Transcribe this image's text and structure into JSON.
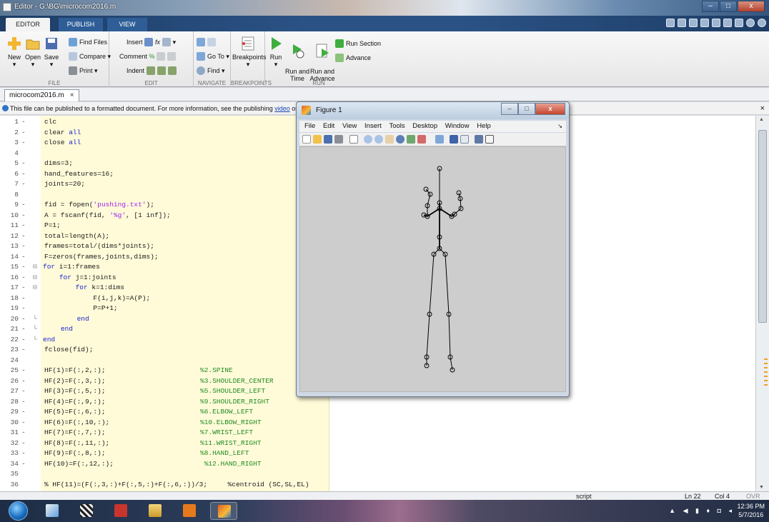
{
  "window": {
    "title": "Editor - G:\\BG\\microcom2016.m"
  },
  "ribbon_tabs": [
    "EDITOR",
    "PUBLISH",
    "VIEW"
  ],
  "ribbon": {
    "file": {
      "new": "New",
      "open": "Open",
      "save": "Save",
      "find_files": "Find Files",
      "compare": "Compare",
      "print": "Print",
      "group": "FILE"
    },
    "edit": {
      "insert": "Insert",
      "comment": "Comment",
      "indent": "Indent",
      "group": "EDIT"
    },
    "navigate": {
      "goto": "Go To",
      "find": "Find",
      "group": "NAVIGATE"
    },
    "breakpoints": {
      "label": "Breakpoints",
      "group": "BREAKPOINTS"
    },
    "run": {
      "run": "Run",
      "run_time": "Run and\nTime",
      "run_advance": "Run and\nAdvance",
      "run_section": "Run Section",
      "advance": "Advance",
      "group": "RUN"
    }
  },
  "doc_tab": {
    "name": "microcom2016.m",
    "close": "×"
  },
  "infobar": {
    "text": "This file can be published to a formatted document. For more information, see the publishing ",
    "link1": "video",
    "or": " or ",
    "link2": "help",
    "end": "."
  },
  "code_lines": [
    {
      "n": "1",
      "d": true,
      "code": "clc"
    },
    {
      "n": "2",
      "d": true,
      "code": "clear all"
    },
    {
      "n": "3",
      "d": true,
      "code": "close all"
    },
    {
      "n": "4",
      "d": false,
      "code": ""
    },
    {
      "n": "5",
      "d": true,
      "code": "dims=3;"
    },
    {
      "n": "6",
      "d": true,
      "code": "hand_features=16;"
    },
    {
      "n": "7",
      "d": true,
      "code": "joints=20;"
    },
    {
      "n": "8",
      "d": false,
      "code": ""
    },
    {
      "n": "9",
      "d": true,
      "code": "fid = fopen('pushing.txt');"
    },
    {
      "n": "10",
      "d": true,
      "code": "A = fscanf(fid, '%g', [1 inf]);"
    },
    {
      "n": "11",
      "d": true,
      "code": "P=1;"
    },
    {
      "n": "12",
      "d": true,
      "code": "total=length(A);"
    },
    {
      "n": "13",
      "d": true,
      "code": "frames=total/(dims*joints);"
    },
    {
      "n": "14",
      "d": true,
      "code": "F=zeros(frames,joints,dims);"
    },
    {
      "n": "15",
      "d": true,
      "code": "for i=1:frames",
      "fold": "⊟",
      "ind": -2
    },
    {
      "n": "16",
      "d": true,
      "code": "    for j=1:joints",
      "fold": "⊟",
      "ind": -2
    },
    {
      "n": "17",
      "d": true,
      "code": "        for k=1:dims",
      "fold": "⊟",
      "ind": -2
    },
    {
      "n": "18",
      "d": true,
      "code": "            F(i,j,k)=A(P);"
    },
    {
      "n": "19",
      "d": true,
      "code": "            P=P+1;"
    },
    {
      "n": "20",
      "d": true,
      "code": "        end",
      "fold": "└"
    },
    {
      "n": "21",
      "d": true,
      "code": "    end",
      "fold": "└"
    },
    {
      "n": "22",
      "d": true,
      "code": "end",
      "fold": "└",
      "ind": -2
    },
    {
      "n": "23",
      "d": true,
      "code": "fclose(fid);"
    },
    {
      "n": "24",
      "d": false,
      "code": ""
    },
    {
      "n": "25",
      "d": true,
      "code": "HF(1)=F(:,2,:);",
      "comment": "%2.SPINE"
    },
    {
      "n": "26",
      "d": true,
      "code": "HF(2)=F(:,3,:);",
      "comment": "%3.SHOULDER_CENTER"
    },
    {
      "n": "27",
      "d": true,
      "code": "HF(3)=F(:,5,:);",
      "comment": "%5.SHOULDER_LEFT"
    },
    {
      "n": "28",
      "d": true,
      "code": "HF(4)=F(:,9,:);",
      "comment": "%9.SHOULDER_RIGHT"
    },
    {
      "n": "29",
      "d": true,
      "code": "HF(5)=F(:,6,:);",
      "comment": "%6.ELBOW_LEFT"
    },
    {
      "n": "30",
      "d": true,
      "code": "HF(6)=F(:,10,:);",
      "comment": "%10.ELBOW_RIGHT"
    },
    {
      "n": "31",
      "d": true,
      "code": "HF(7)=F(:,7,:);",
      "comment": "%7.WRIST_LEFT"
    },
    {
      "n": "32",
      "d": true,
      "code": "HF(8)=F(:,11,:);",
      "comment": "%11.WRIST_RIGHT"
    },
    {
      "n": "33",
      "d": true,
      "code": "HF(9)=F(:,8,:);",
      "comment": "%8.HAND_LEFT"
    },
    {
      "n": "34",
      "d": true,
      "code": "HF(10)=F(:,12,:);",
      "comment": " %12.HAND_RIGHT"
    },
    {
      "n": "35",
      "d": false,
      "code": ""
    },
    {
      "n": "36",
      "d": false,
      "code": "% HF(11)=(F(:,3,:)+F(:,5,:)+F(:,6,:))/3;     %centroid (SC,SL,EL)",
      "allcomment": true
    }
  ],
  "figure": {
    "title": "Figure 1",
    "menu": [
      "File",
      "Edit",
      "View",
      "Insert",
      "Tools",
      "Desktop",
      "Window",
      "Help"
    ],
    "menu_arrow": "↘"
  },
  "statusbar": {
    "mode": "script",
    "ln": "Ln  22",
    "col": "Col  4",
    "ovr": "OVR"
  },
  "taskbar": {
    "time": "12:36 PM",
    "date": "5/7/2016"
  }
}
